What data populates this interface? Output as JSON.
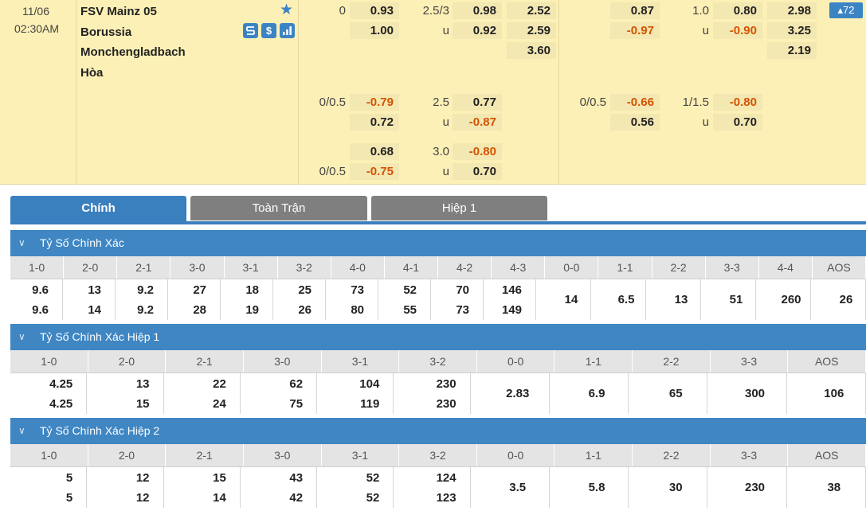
{
  "match": {
    "date": "11/06",
    "time": "02:30AM",
    "home": "FSV Mainz 05",
    "away_line1": "Borussia",
    "away_line2": "Monchengladbach",
    "draw": "Hòa",
    "badge": "▴72"
  },
  "odds": {
    "ft_hdp_main": {
      "line": "0",
      "home": "0.93",
      "away": "1.00"
    },
    "ft_ou_main": {
      "line": "2.5/3",
      "over": "0.98",
      "u": "u",
      "under": "0.92"
    },
    "ft_1x2": {
      "home": "2.52",
      "away": "2.59",
      "draw": "3.60"
    },
    "h1_hdp_main": {
      "line": "0",
      "home": "0.87",
      "away": "-0.97"
    },
    "h1_ou_main": {
      "line": "1.0",
      "over": "0.80",
      "u": "u",
      "under": "-0.90"
    },
    "h1_1x2": {
      "home": "2.98",
      "away": "3.25",
      "draw": "2.19"
    },
    "ft_hdp_alt1": {
      "line": "0/0.5",
      "home": "-0.79",
      "away": "0.72"
    },
    "ft_ou_alt1": {
      "line": "2.5",
      "over": "0.77",
      "u": "u",
      "under": "-0.87"
    },
    "h1_hdp_alt1": {
      "line": "0/0.5",
      "home": "-0.66",
      "away": "0.56"
    },
    "h1_ou_alt1": {
      "line": "1/1.5",
      "over": "-0.80",
      "u": "u",
      "under": "0.70"
    },
    "ft_hdp_alt2": {
      "line": "0/0.5",
      "home": "0.68",
      "away": "-0.75"
    },
    "ft_ou_alt2": {
      "line": "3.0",
      "over": "-0.80",
      "u": "u",
      "under": "0.70"
    }
  },
  "tabs": [
    "Chính",
    "Toàn Trận",
    "Hiệp 1"
  ],
  "sections": [
    {
      "title": "Tỷ Số Chính Xác",
      "headers": [
        "1-0",
        "2-0",
        "2-1",
        "3-0",
        "3-1",
        "3-2",
        "4-0",
        "4-1",
        "4-2",
        "4-3",
        "0-0",
        "1-1",
        "2-2",
        "3-3",
        "4-4",
        "AOS"
      ],
      "values": [
        [
          "9.6",
          "9.6"
        ],
        [
          "13",
          "14"
        ],
        [
          "9.2",
          "9.2"
        ],
        [
          "27",
          "28"
        ],
        [
          "18",
          "19"
        ],
        [
          "25",
          "26"
        ],
        [
          "73",
          "80"
        ],
        [
          "52",
          "55"
        ],
        [
          "70",
          "73"
        ],
        [
          "146",
          "149"
        ],
        [
          "14"
        ],
        [
          "6.5"
        ],
        [
          "13"
        ],
        [
          "51"
        ],
        [
          "260"
        ],
        [
          "26"
        ]
      ]
    },
    {
      "title": "Tỷ Số Chính Xác Hiệp 1",
      "headers": [
        "1-0",
        "2-0",
        "2-1",
        "3-0",
        "3-1",
        "3-2",
        "0-0",
        "1-1",
        "2-2",
        "3-3",
        "AOS"
      ],
      "values": [
        [
          "4.25",
          "4.25"
        ],
        [
          "13",
          "15"
        ],
        [
          "22",
          "24"
        ],
        [
          "62",
          "75"
        ],
        [
          "104",
          "119"
        ],
        [
          "230",
          "230"
        ],
        [
          "2.83"
        ],
        [
          "6.9"
        ],
        [
          "65"
        ],
        [
          "300"
        ],
        [
          "106"
        ]
      ]
    },
    {
      "title": "Tỷ Số Chính Xác Hiệp 2",
      "headers": [
        "1-0",
        "2-0",
        "2-1",
        "3-0",
        "3-1",
        "3-2",
        "0-0",
        "1-1",
        "2-2",
        "3-3",
        "AOS"
      ],
      "values": [
        [
          "5",
          "5"
        ],
        [
          "12",
          "12"
        ],
        [
          "15",
          "14"
        ],
        [
          "43",
          "42"
        ],
        [
          "52",
          "52"
        ],
        [
          "124",
          "123"
        ],
        [
          "3.5"
        ],
        [
          "5.8"
        ],
        [
          "30"
        ],
        [
          "230"
        ],
        [
          "38"
        ]
      ]
    }
  ]
}
